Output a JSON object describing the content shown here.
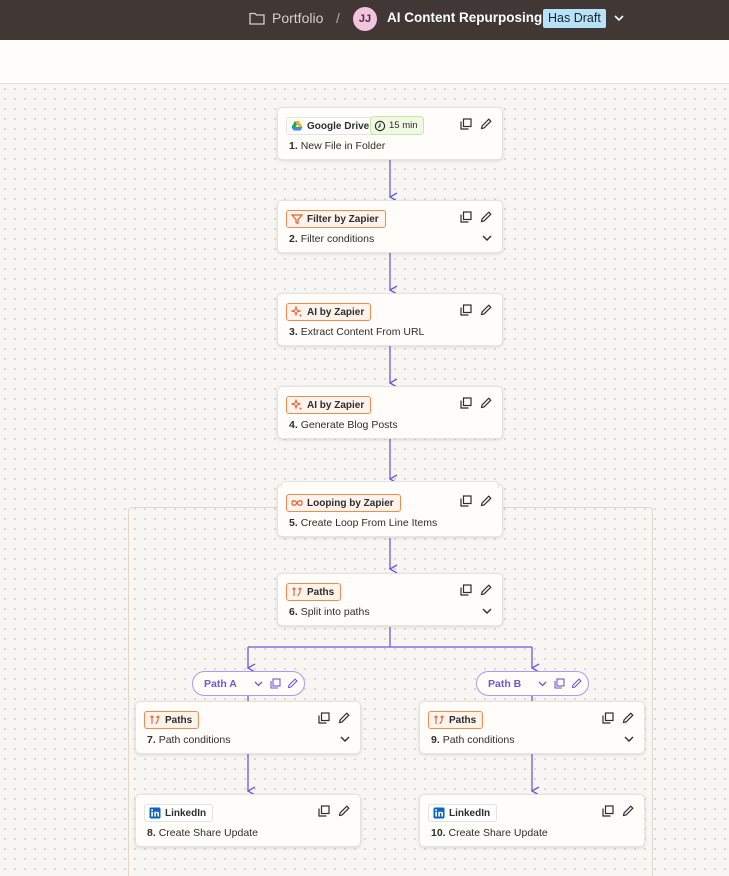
{
  "header": {
    "breadcrumb": "Portfolio",
    "separator": "/",
    "avatar_initials": "JJ",
    "title": "AI Content Repurposing",
    "draft_badge": "Has Draft"
  },
  "colors": {
    "header_bg": "#413735",
    "accent_wire": "#6a5ad8",
    "chip_orange": "#f08a52",
    "draft_badge": "#b7e2f8",
    "duration_badge": "#eef8e2"
  },
  "steps": [
    {
      "app": "Google Drive",
      "icon": "google-drive-icon",
      "duration": "15 min",
      "num": "1.",
      "title": "New File in Folder"
    },
    {
      "app": "Filter by Zapier",
      "icon": "filter-icon",
      "num": "2.",
      "title": "Filter conditions"
    },
    {
      "app": "AI by Zapier",
      "icon": "ai-sparkle-icon",
      "num": "3.",
      "title": "Extract Content From URL"
    },
    {
      "app": "AI by Zapier",
      "icon": "ai-sparkle-icon",
      "num": "4.",
      "title": "Generate Blog Posts"
    },
    {
      "app": "Looping by Zapier",
      "icon": "loop-icon",
      "num": "5.",
      "title": "Create Loop From Line Items"
    },
    {
      "app": "Paths",
      "icon": "paths-icon",
      "num": "6.",
      "title": "Split into paths"
    },
    {
      "app": "Paths",
      "icon": "paths-icon",
      "num": "7.",
      "title": "Path conditions"
    },
    {
      "app": "LinkedIn",
      "icon": "linkedin-icon",
      "num": "8.",
      "title": "Create Share Update"
    },
    {
      "app": "Paths",
      "icon": "paths-icon",
      "num": "9.",
      "title": "Path conditions"
    },
    {
      "app": "LinkedIn",
      "icon": "linkedin-icon",
      "num": "10.",
      "title": "Create Share Update"
    }
  ],
  "paths": [
    {
      "label": "Path A"
    },
    {
      "label": "Path B"
    }
  ]
}
